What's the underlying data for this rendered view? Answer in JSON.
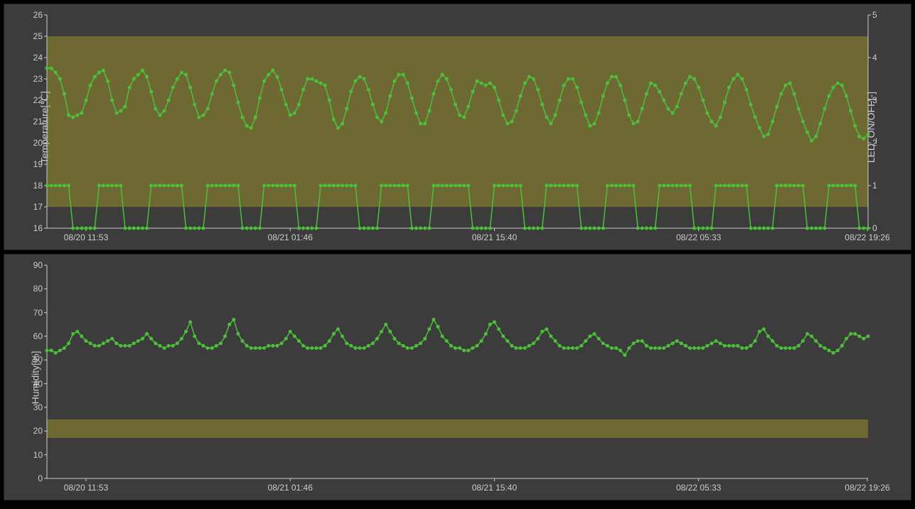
{
  "colors": {
    "bg": "#3c3c3c",
    "series": "#4dbf3a",
    "band": "rgba(170,160,40,0.45)",
    "axis": "#ccc"
  },
  "x_ticks": [
    "08/20 11:53",
    "08/21 01:46",
    "08/21 15:40",
    "08/22 05:33",
    "08/22 19:26"
  ],
  "chart_data": [
    {
      "id": "top",
      "type": "line",
      "xlabel": "",
      "y_left": {
        "label": "Temperature[℃]",
        "min": 16,
        "max": 26,
        "ticks": [
          16,
          17,
          18,
          19,
          20,
          21,
          22,
          23,
          24,
          25,
          26
        ]
      },
      "y_right": {
        "label": "LED_ON/OFF[-]",
        "min": 0,
        "max": 5,
        "ticks": [
          0,
          1,
          2,
          3,
          4,
          5
        ]
      },
      "band_left": {
        "from": 17,
        "to": 25
      },
      "series": [
        {
          "name": "Temperature",
          "axis": "left",
          "values": [
            23.5,
            23.5,
            23.3,
            23.0,
            22.3,
            21.3,
            21.2,
            21.3,
            21.4,
            22.0,
            22.7,
            23.1,
            23.3,
            23.4,
            22.9,
            22.0,
            21.4,
            21.5,
            21.7,
            22.6,
            23.0,
            23.2,
            23.4,
            23.1,
            22.4,
            21.6,
            21.3,
            21.5,
            22.0,
            22.6,
            23.0,
            23.3,
            23.2,
            22.6,
            21.8,
            21.2,
            21.3,
            21.6,
            22.3,
            22.9,
            23.2,
            23.4,
            23.3,
            22.7,
            21.9,
            21.2,
            20.8,
            20.7,
            21.2,
            22.1,
            22.9,
            23.2,
            23.4,
            23.1,
            22.5,
            21.8,
            21.3,
            21.4,
            21.8,
            22.5,
            23.0,
            23.0,
            22.9,
            22.8,
            22.7,
            22.0,
            21.1,
            20.7,
            20.9,
            21.6,
            22.4,
            22.9,
            23.1,
            23.0,
            22.5,
            21.8,
            21.2,
            21.0,
            21.4,
            22.2,
            22.9,
            23.2,
            23.2,
            22.8,
            22.1,
            21.4,
            20.9,
            20.9,
            21.5,
            22.3,
            22.9,
            23.2,
            23.0,
            22.5,
            21.8,
            21.3,
            21.2,
            21.7,
            22.4,
            22.9,
            22.8,
            22.7,
            22.8,
            22.6,
            22.0,
            21.3,
            20.9,
            21.0,
            21.5,
            22.2,
            22.8,
            23.1,
            23.0,
            22.5,
            21.8,
            21.2,
            20.9,
            21.3,
            22.0,
            22.7,
            23.0,
            23.0,
            22.6,
            21.9,
            21.3,
            20.8,
            20.9,
            21.4,
            22.2,
            22.8,
            23.1,
            23.1,
            22.7,
            22.0,
            21.3,
            20.9,
            21.0,
            21.6,
            22.3,
            22.8,
            22.7,
            22.4,
            22.0,
            21.6,
            21.4,
            21.7,
            22.3,
            22.8,
            23.1,
            23.0,
            22.6,
            22.0,
            21.4,
            21.0,
            20.8,
            21.2,
            21.9,
            22.6,
            23.0,
            23.2,
            23.0,
            22.5,
            21.8,
            21.2,
            20.7,
            20.3,
            20.4,
            21.0,
            21.7,
            22.3,
            22.7,
            22.8,
            22.3,
            21.6,
            21.0,
            20.5,
            20.1,
            20.3,
            20.9,
            21.6,
            22.2,
            22.6,
            22.8,
            22.7,
            22.2,
            21.5,
            20.8,
            20.3,
            20.2,
            20.4
          ]
        },
        {
          "name": "LED_ON/OFF",
          "axis": "right",
          "values": [
            1,
            1,
            1,
            1,
            1,
            1,
            0,
            0,
            0,
            0,
            0,
            0,
            1,
            1,
            1,
            1,
            1,
            1,
            0,
            0,
            0,
            0,
            0,
            0,
            1,
            1,
            1,
            1,
            1,
            1,
            1,
            1,
            0,
            0,
            0,
            0,
            0,
            1,
            1,
            1,
            1,
            1,
            1,
            1,
            1,
            0,
            0,
            0,
            0,
            0,
            1,
            1,
            1,
            1,
            1,
            1,
            1,
            1,
            0,
            0,
            0,
            0,
            0,
            1,
            1,
            1,
            1,
            1,
            1,
            1,
            1,
            1,
            0,
            0,
            0,
            0,
            0,
            1,
            1,
            1,
            1,
            1,
            1,
            1,
            0,
            0,
            0,
            0,
            0,
            1,
            1,
            1,
            1,
            1,
            1,
            1,
            1,
            1,
            0,
            0,
            0,
            0,
            0,
            1,
            1,
            1,
            1,
            1,
            1,
            1,
            0,
            0,
            0,
            0,
            0,
            1,
            1,
            1,
            1,
            1,
            1,
            1,
            1,
            0,
            0,
            0,
            0,
            0,
            0,
            1,
            1,
            1,
            1,
            1,
            1,
            1,
            0,
            0,
            0,
            0,
            0,
            1,
            1,
            1,
            1,
            1,
            1,
            1,
            1,
            0,
            0,
            0,
            0,
            0,
            1,
            1,
            1,
            1,
            1,
            1,
            1,
            1,
            0,
            0,
            0,
            0,
            0,
            0,
            1,
            1,
            1,
            1,
            1,
            1,
            1,
            0,
            0,
            0,
            0,
            0,
            1,
            1,
            1,
            1,
            1,
            1,
            1,
            0,
            0,
            0
          ]
        }
      ]
    },
    {
      "id": "bot",
      "type": "line",
      "xlabel": "",
      "y_left": {
        "label": "Humidity[%]",
        "min": 0,
        "max": 90,
        "ticks": [
          0,
          10,
          20,
          30,
          40,
          50,
          60,
          70,
          80,
          90
        ]
      },
      "y_right": null,
      "band_left": {
        "from": 17,
        "to": 25
      },
      "series": [
        {
          "name": "Humidity",
          "axis": "left",
          "values": [
            54,
            54,
            53,
            54,
            55,
            57,
            61,
            62,
            60,
            58,
            57,
            56,
            56,
            57,
            58,
            59,
            57,
            56,
            56,
            56,
            57,
            58,
            59,
            61,
            59,
            57,
            56,
            55,
            56,
            56,
            57,
            59,
            62,
            66,
            60,
            57,
            56,
            55,
            55,
            56,
            57,
            60,
            65,
            67,
            61,
            58,
            56,
            55,
            55,
            55,
            55,
            56,
            56,
            56,
            57,
            59,
            62,
            60,
            58,
            56,
            55,
            55,
            55,
            55,
            56,
            58,
            61,
            63,
            60,
            57,
            56,
            55,
            55,
            55,
            56,
            57,
            59,
            62,
            65,
            62,
            59,
            57,
            56,
            55,
            55,
            56,
            57,
            59,
            63,
            67,
            64,
            60,
            58,
            56,
            55,
            55,
            54,
            54,
            55,
            56,
            58,
            61,
            65,
            66,
            63,
            60,
            58,
            56,
            55,
            55,
            55,
            56,
            57,
            59,
            62,
            63,
            60,
            58,
            56,
            55,
            55,
            55,
            55,
            56,
            58,
            60,
            61,
            59,
            57,
            56,
            55,
            55,
            54,
            52,
            55,
            57,
            58,
            58,
            56,
            55,
            55,
            55,
            55,
            56,
            57,
            58,
            57,
            56,
            55,
            55,
            55,
            55,
            56,
            57,
            58,
            57,
            56,
            56,
            56,
            56,
            55,
            55,
            56,
            58,
            62,
            63,
            60,
            58,
            56,
            55,
            55,
            55,
            55,
            56,
            58,
            61,
            60,
            58,
            56,
            55,
            54,
            53,
            54,
            56,
            59,
            61,
            61,
            60,
            59,
            60
          ]
        }
      ]
    }
  ]
}
